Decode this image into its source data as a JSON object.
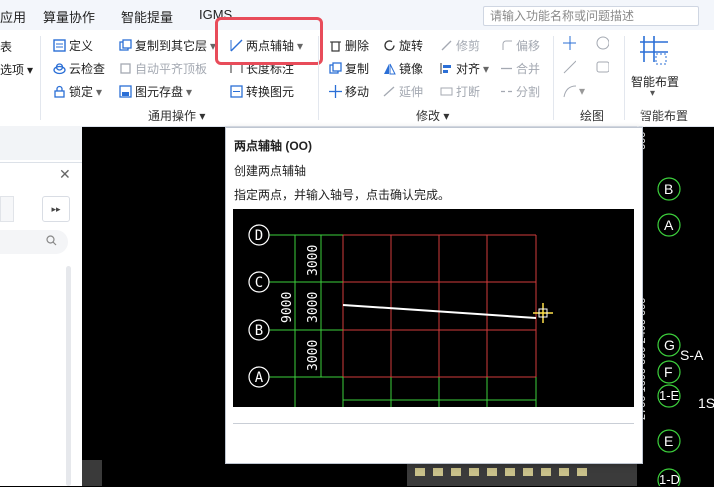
{
  "menubar": {
    "items": [
      "应用",
      "算量协作",
      "智能提量",
      "IGMS"
    ],
    "search_placeholder": "请输入功能名称或问题描述"
  },
  "ribbon": {
    "buttons": {
      "define": "定义",
      "cloud_check": "云检查",
      "lock": "锁定",
      "copy_to_layer": "复制到其它层",
      "auto_roof": "自动平齐顶板",
      "element_store": "图元存盘",
      "two_point_axis": "两点辅轴",
      "length_mark": "长度标注",
      "convert_element": "转换图元",
      "delete": "删除",
      "copy": "复制",
      "move": "移动",
      "rotate": "旋转",
      "mirror": "镜像",
      "extend": "延伸",
      "trim": "修剪",
      "align": "对齐",
      "break": "打断",
      "offset": "偏移",
      "merge": "合并",
      "split": "分割",
      "smart_layout": "智能布置",
      "left_partial_top": "表",
      "left_partial_mid": "选项"
    },
    "groups": {
      "common_ops": "通用操作",
      "modify": "修改",
      "draw": "绘图",
      "smart_layout": "智能布置"
    }
  },
  "tooltip": {
    "title": "两点辅轴 (OO)",
    "line1": "创建两点辅轴",
    "line2": "指定两点，并输入轴号，点击确认完成。",
    "preview": {
      "axis_labels": [
        "D",
        "C",
        "B",
        "A"
      ],
      "dims": [
        "3000",
        "3000",
        "3000"
      ],
      "total_dim": "9000"
    }
  },
  "canvas": {
    "axis_labels": [
      "B",
      "A",
      "G",
      "F",
      "1-E",
      "E",
      "1-D"
    ],
    "extra_text": [
      "S-A",
      "1S"
    ],
    "vertical_dim_top": "600 700",
    "vertical_dim_bottom": "2700 1600 600 2400 600"
  },
  "colors": {
    "highlight": "#e84c5a",
    "grid_red": "#d23b3b",
    "grid_green": "#3ccf3c"
  }
}
